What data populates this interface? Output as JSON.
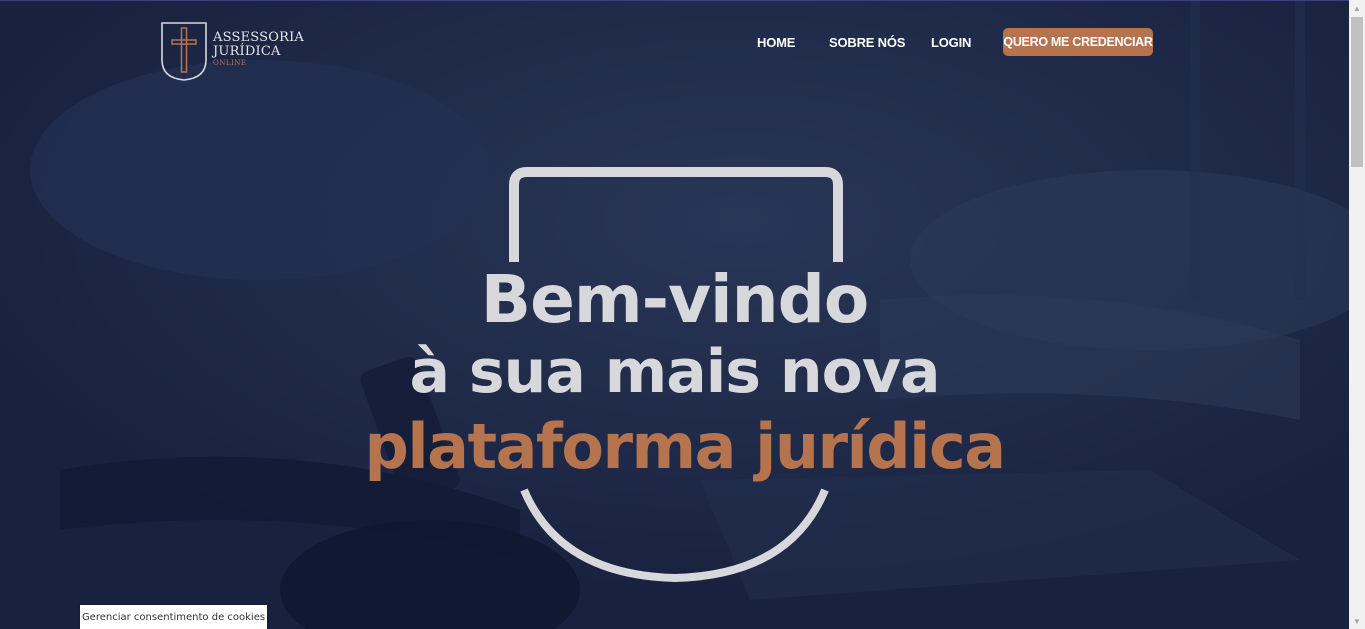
{
  "logo": {
    "line1": "ASSESSORIA",
    "line2": "JURÍDICA",
    "line3": "ONLINE",
    "icon": "shield-sword-icon"
  },
  "nav": {
    "home": "HOME",
    "sobre": "SOBRE NÓS",
    "login": "LOGIN",
    "cta": "QUERO ME CREDENCIAR"
  },
  "hero": {
    "line1": "Bem-vindo",
    "line2": "à sua mais nova",
    "line3": "plataforma jurídica"
  },
  "cookie": {
    "label": "Gerenciar consentimento de cookies"
  },
  "colors": {
    "background": "#1a2543",
    "accent": "#b5734e",
    "hero_text": "#d7d8dc"
  }
}
